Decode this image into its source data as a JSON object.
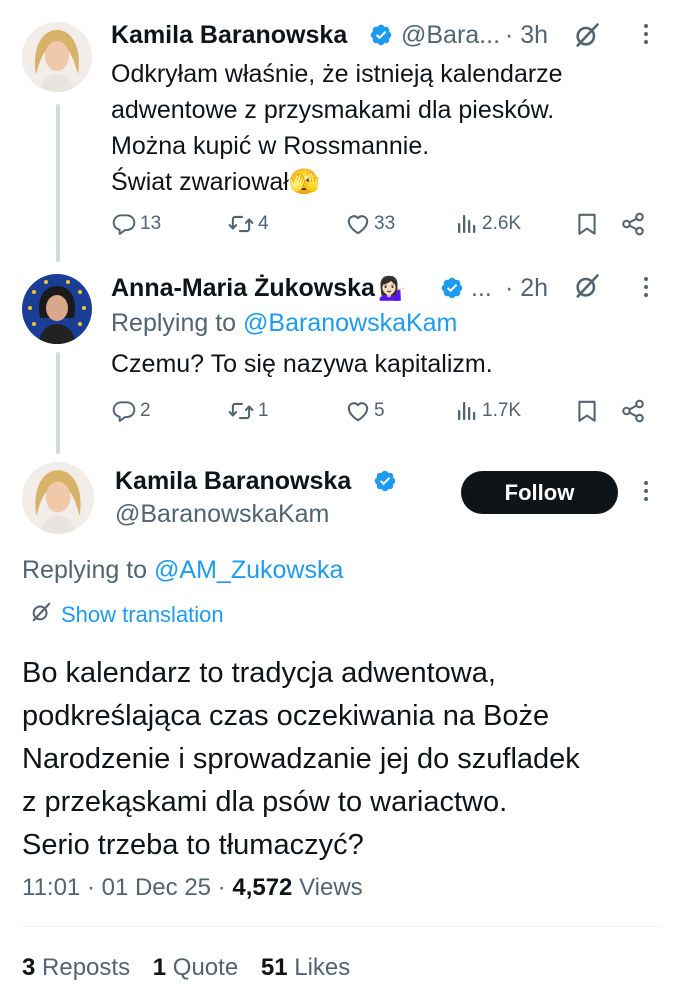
{
  "tweet1": {
    "name": "Kamila Baranowska",
    "handle": "@Bara...",
    "time": "· 3h",
    "lines": [
      "Odkryłam właśnie, że istnieją kalendarze",
      "adwentowe z przysmakami dla piesków.",
      "Można kupić w Rossmannie.",
      "Świat zwariował"
    ],
    "emoji": "🫣",
    "replies": "13",
    "reposts": "4",
    "likes": "33",
    "views": "2.6K"
  },
  "tweet2": {
    "name": "Anna-Maria Żukowska",
    "name_emoji": "💁🏻‍♀️",
    "handle": "...",
    "time": "· 2h",
    "replying_prefix": "Replying to",
    "replying_handle": "@BaranowskaKam",
    "text": "Czemu? To się nazywa kapitalizm.",
    "replies": "2",
    "reposts": "1",
    "likes": "5",
    "views": "1.7K"
  },
  "main": {
    "name": "Kamila Baranowska",
    "handle": "@BaranowskaKam",
    "follow_label": "Follow",
    "replying_prefix": "Replying to",
    "replying_handle": "@AM_Zukowska",
    "show_translation": "Show translation",
    "lines": [
      "Bo kalendarz to tradycja adwentowa,",
      "podkreślająca czas oczekiwania na Boże",
      "Narodzenie i sprowadzanie jej do szufladek",
      "z przekąskami dla psów to wariactwo.",
      "Serio trzeba to tłumaczyć?"
    ],
    "time": "11:01",
    "date": "01 Dec 25",
    "views_count": "4,572",
    "views_label": "Views",
    "reposts_count": "3",
    "reposts_label": "Reposts",
    "quotes_count": "1",
    "quotes_label": "Quote",
    "likes_count": "51",
    "likes_label": "Likes"
  },
  "colors": {
    "accent": "#1d9bf0",
    "text": "#0f1419",
    "secondary": "#536471",
    "follow_bg": "#0f1419"
  }
}
